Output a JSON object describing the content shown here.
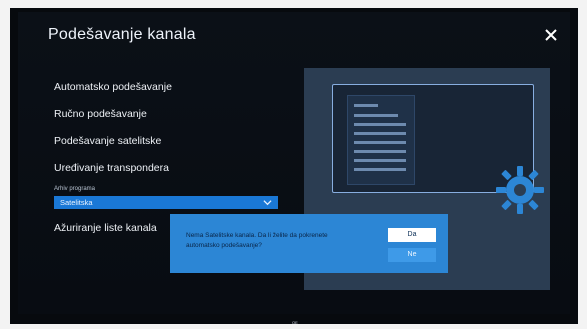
{
  "header": {
    "title": "Podešavanje kanala",
    "close_icon": "close-icon"
  },
  "menu": {
    "items": [
      {
        "label": "Automatsko podešavanje"
      },
      {
        "label": "Ručno podešavanje"
      },
      {
        "label": "Podešavanje satelitske"
      },
      {
        "label": "Uređivanje transpondera"
      }
    ],
    "archive_label": "Arhiv programa",
    "dropdown_value": "Satelitska",
    "last_item": "Ažuriranje liste kanala"
  },
  "dialog": {
    "message": "Nema Satelitske kanala. Da li želite da pokrenete automatsko podešavanje?",
    "yes_label": "Da",
    "no_label": "Ne"
  },
  "footer": {
    "small_text": "ОЕ"
  },
  "colors": {
    "accent_blue": "#1a78d6",
    "dialog_blue": "#2c86d5",
    "screen_bg": "#080c12",
    "preview_bg": "#2b3d52"
  }
}
